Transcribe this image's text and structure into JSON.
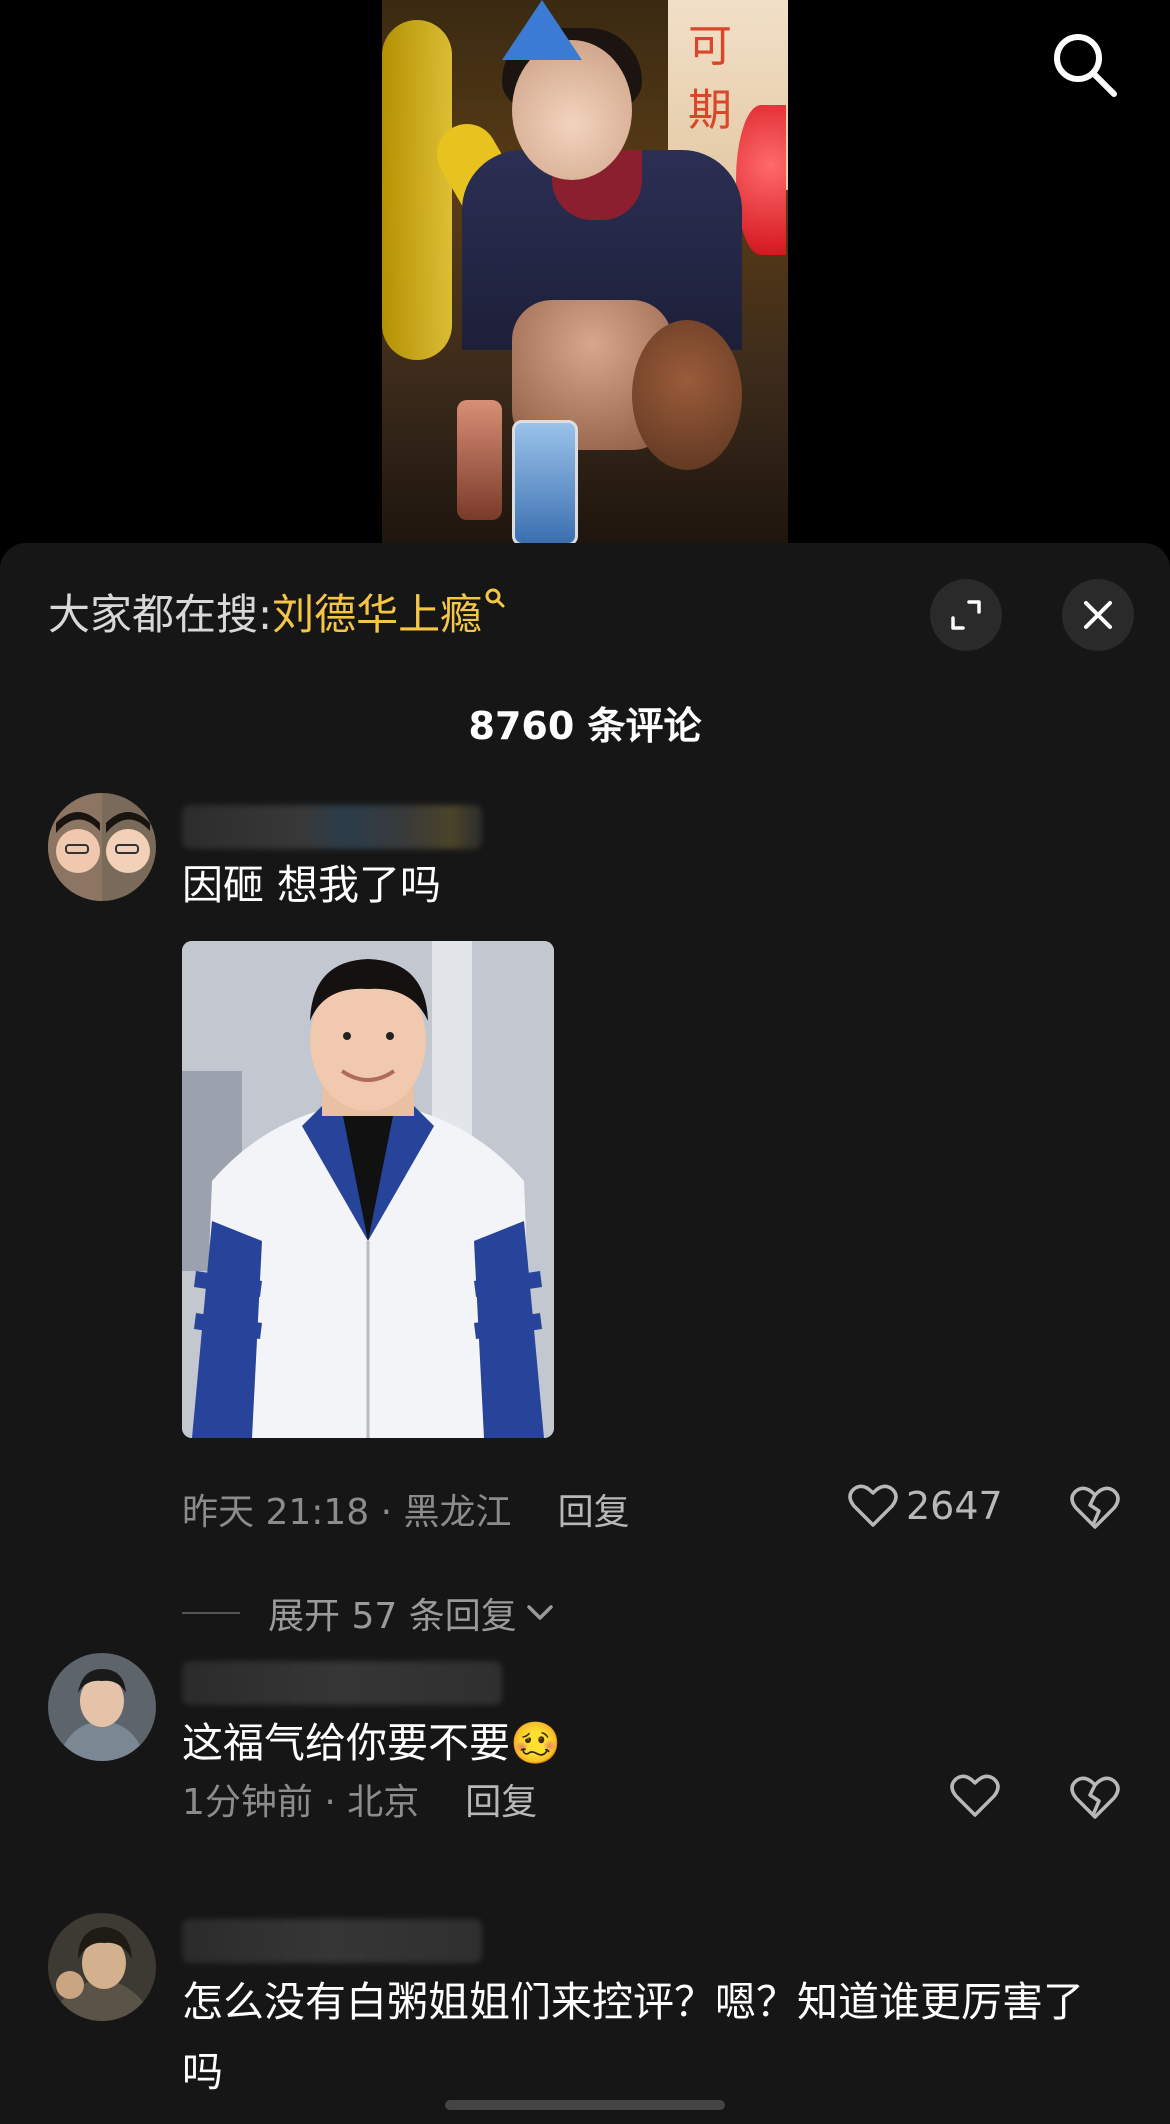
{
  "video": {
    "banner_text": "可 期"
  },
  "sheet": {
    "trending_prefix": "大家都在搜:",
    "trending_keyword": "刘德华上瘾",
    "comment_count": "8760 条评论"
  },
  "comments": [
    {
      "text": "因砸 想我了吗",
      "time": "昨天 21:18",
      "location": "黑龙江",
      "reply_label": "回复",
      "likes": "2647",
      "expand_label": "展开 57 条回复",
      "has_image": true
    },
    {
      "text": "这福气给你要不要",
      "emoji": "🥴",
      "time": "1分钟前",
      "location": "北京",
      "reply_label": "回复",
      "likes": ""
    },
    {
      "text": "怎么没有白粥姐姐们来控评？嗯？知道谁更厉害了吗"
    }
  ],
  "icons": {
    "search": "search-icon",
    "expand": "expand-icon",
    "close": "close-icon",
    "like": "heart-icon",
    "dislike": "broken-heart-icon",
    "chevron": "chevron-down-icon"
  },
  "colors": {
    "sheet_bg": "#161616",
    "keyword": "#f5c646",
    "muted": "#8c8c8c"
  }
}
